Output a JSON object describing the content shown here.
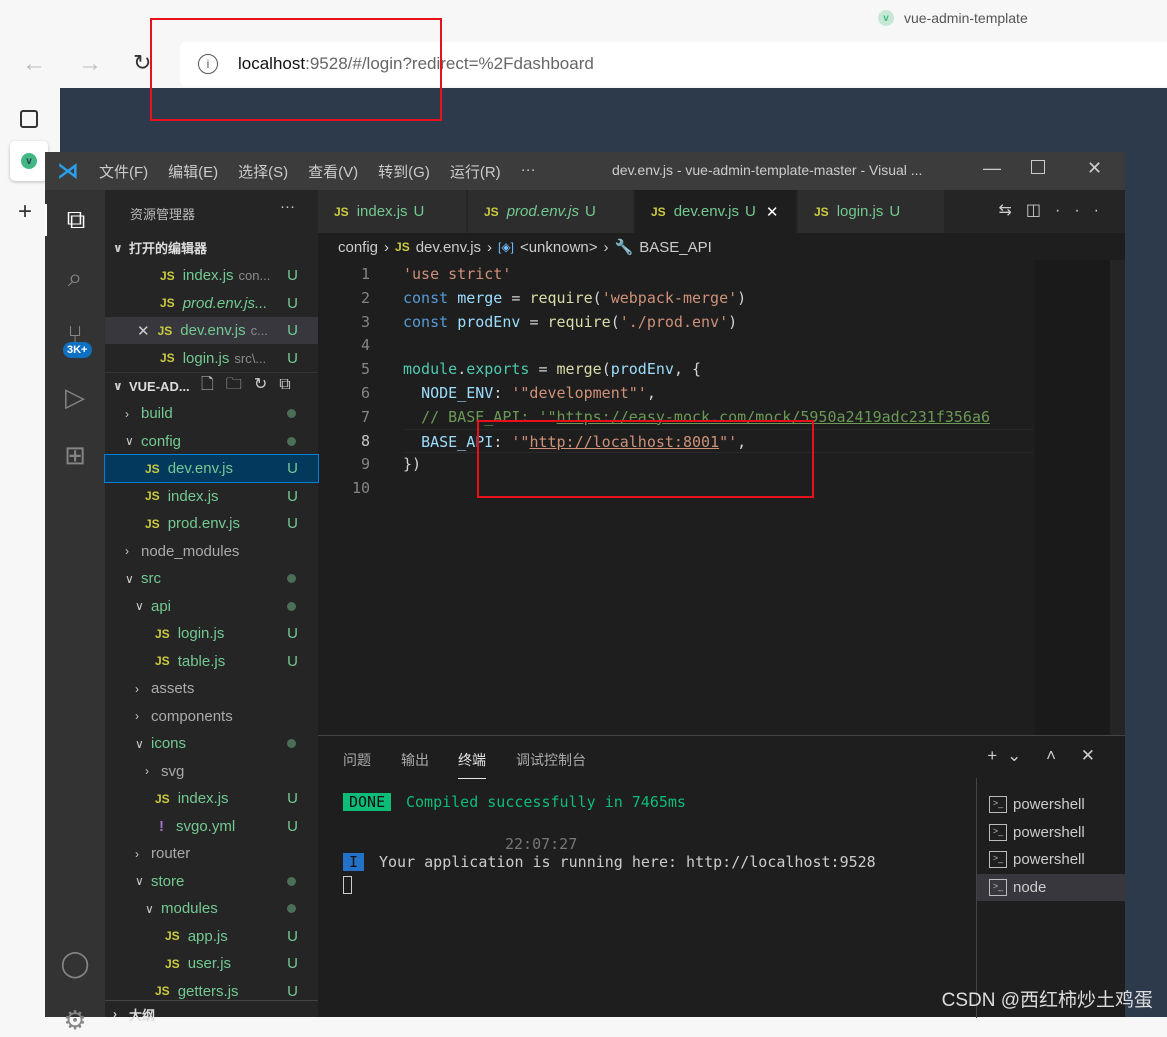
{
  "browser": {
    "tab_title": "vue-admin-template",
    "url_host": "localhost",
    "url_rest": ":9528/#/login?redirect=%2Fdashboard"
  },
  "vscode": {
    "menu": [
      "文件(F)",
      "编辑(E)",
      "选择(S)",
      "查看(V)",
      "转到(G)",
      "运行(R)",
      "···"
    ],
    "title": "dev.env.js - vue-admin-template-master - Visual ...",
    "explorer_title": "资源管理器",
    "open_editors_title": "打开的编辑器",
    "open_editors": [
      {
        "name": "index.js",
        "hint": "con...",
        "status": "U"
      },
      {
        "name": "prod.env.js...",
        "hint": "",
        "status": "U",
        "italic": true
      },
      {
        "name": "dev.env.js",
        "hint": "c...",
        "status": "U",
        "selected": true
      },
      {
        "name": "login.js",
        "hint": "src\\...",
        "status": "U"
      }
    ],
    "project_title": "VUE-AD...",
    "tree": [
      {
        "name": "build",
        "depth": 0,
        "type": "folder",
        "open": false,
        "status": "dot"
      },
      {
        "name": "config",
        "depth": 0,
        "type": "folder",
        "open": true,
        "status": "dot"
      },
      {
        "name": "dev.env.js",
        "depth": 1,
        "type": "file",
        "status": "U",
        "selected": true
      },
      {
        "name": "index.js",
        "depth": 1,
        "type": "file",
        "status": "U"
      },
      {
        "name": "prod.env.js",
        "depth": 1,
        "type": "file",
        "status": "U"
      },
      {
        "name": "node_modules",
        "depth": 0,
        "type": "folder",
        "open": false,
        "status": "",
        "muted": true
      },
      {
        "name": "src",
        "depth": 0,
        "type": "folder",
        "open": true,
        "status": "dot"
      },
      {
        "name": "api",
        "depth": 1,
        "type": "folder",
        "open": true,
        "status": "dot"
      },
      {
        "name": "login.js",
        "depth": 2,
        "type": "file",
        "status": "U"
      },
      {
        "name": "table.js",
        "depth": 2,
        "type": "file",
        "status": "U"
      },
      {
        "name": "assets",
        "depth": 1,
        "type": "folder",
        "open": false,
        "status": "",
        "muted": true
      },
      {
        "name": "components",
        "depth": 1,
        "type": "folder",
        "open": false,
        "status": "",
        "muted": true
      },
      {
        "name": "icons",
        "depth": 1,
        "type": "folder",
        "open": true,
        "status": "dot"
      },
      {
        "name": "svg",
        "depth": 2,
        "type": "folder",
        "open": false,
        "status": "",
        "muted": true
      },
      {
        "name": "index.js",
        "depth": 2,
        "type": "file",
        "status": "U"
      },
      {
        "name": "svgo.yml",
        "depth": 2,
        "type": "yml",
        "status": "U"
      },
      {
        "name": "router",
        "depth": 1,
        "type": "folder",
        "open": false,
        "status": "",
        "muted": true
      },
      {
        "name": "store",
        "depth": 1,
        "type": "folder",
        "open": true,
        "status": "dot"
      },
      {
        "name": "modules",
        "depth": 2,
        "type": "folder",
        "open": true,
        "status": "dot"
      },
      {
        "name": "app.js",
        "depth": 3,
        "type": "file",
        "status": "U"
      },
      {
        "name": "user.js",
        "depth": 3,
        "type": "file",
        "status": "U"
      },
      {
        "name": "getters.js",
        "depth": 2,
        "type": "file",
        "status": "U"
      }
    ],
    "outline_title": "大纲",
    "tabs": [
      {
        "name": "index.js",
        "status": "U"
      },
      {
        "name": "prod.env.js",
        "status": "U",
        "italic": true
      },
      {
        "name": "dev.env.js",
        "status": "U",
        "active": true
      },
      {
        "name": "login.js",
        "status": "U"
      }
    ],
    "breadcrumb": [
      "config",
      "dev.env.js",
      "<unknown>",
      "BASE_API"
    ],
    "activity_badge": "3K+",
    "panel_tabs": [
      "问题",
      "输出",
      "终端",
      "调试控制台"
    ],
    "terminal": {
      "done": "DONE",
      "compiled": "Compiled successfully in 7465ms",
      "time": "22:07:27",
      "info": "I",
      "running": "Your application is running here: http://localhost:9528"
    },
    "terminals": [
      "powershell",
      "powershell",
      "powershell",
      "node"
    ]
  },
  "watermark": "CSDN @西红柿炒土鸡蛋"
}
